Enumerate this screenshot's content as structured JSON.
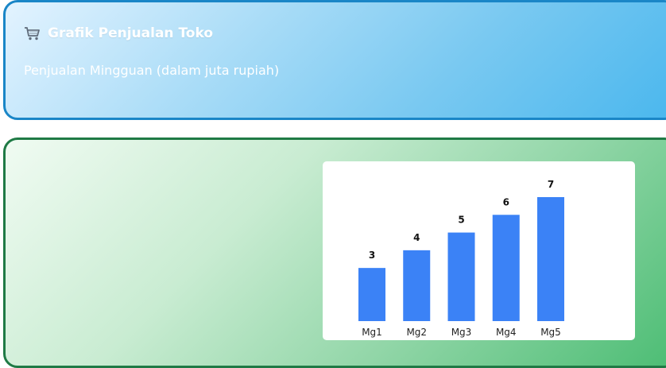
{
  "header": {
    "icon": "shopping-cart-icon",
    "title": "Grafik Penjualan Toko",
    "subtitle": "Penjualan Mingguan (dalam juta rupiah)"
  },
  "colors": {
    "bar": "#3b82f6",
    "header_border": "#1a86c7",
    "chart_border": "#1f7a45"
  },
  "chart_data": {
    "type": "bar",
    "categories": [
      "Mg1",
      "Mg2",
      "Mg3",
      "Mg4",
      "Mg5"
    ],
    "values": [
      3,
      4,
      5,
      6,
      7
    ],
    "ylim": [
      0,
      7
    ],
    "grid": false,
    "legend": "none",
    "show_data_labels": true
  }
}
